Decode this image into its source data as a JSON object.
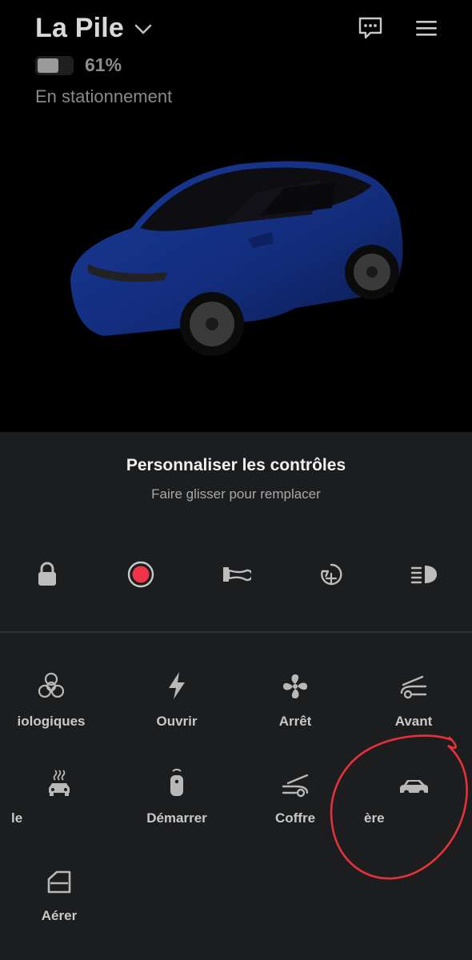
{
  "vehicle": {
    "name": "La Pile",
    "battery_percent": "61%",
    "battery_level": 0.61,
    "status": "En stationnement"
  },
  "header": {
    "icons": [
      "chevron-down-icon",
      "chat-icon",
      "menu-icon"
    ]
  },
  "panel": {
    "title": "Personnaliser les contrôles",
    "subtitle": "Faire glisser pour remplacer",
    "quick_controls": [
      "lock-icon",
      "record-icon",
      "horn-icon",
      "fan-defrost-icon",
      "headlights-icon"
    ],
    "tiles": [
      {
        "icon": "biohazard-icon",
        "label": "iologiques"
      },
      {
        "icon": "lightning-icon",
        "label": "Ouvrir"
      },
      {
        "icon": "fan-icon",
        "label": "Arrêt"
      },
      {
        "icon": "frunk-icon",
        "label": "Avant"
      },
      {
        "icon": "heated-car-icon",
        "label": "le"
      },
      {
        "icon": "key-fob-icon",
        "label": "Démarrer"
      },
      {
        "icon": "trunk-icon",
        "label": "Coffre"
      },
      {
        "icon": "car-side-icon",
        "label": "ère"
      },
      {
        "icon": "window-icon",
        "label": "Aérer"
      }
    ]
  },
  "colors": {
    "background_top": "#000000",
    "panel_background": "#1c1d1f",
    "record_red": "#f0334b",
    "annotation_red": "#e8303a",
    "icon_gray": "#b8b8b8",
    "car_blue": "#122c7a"
  }
}
